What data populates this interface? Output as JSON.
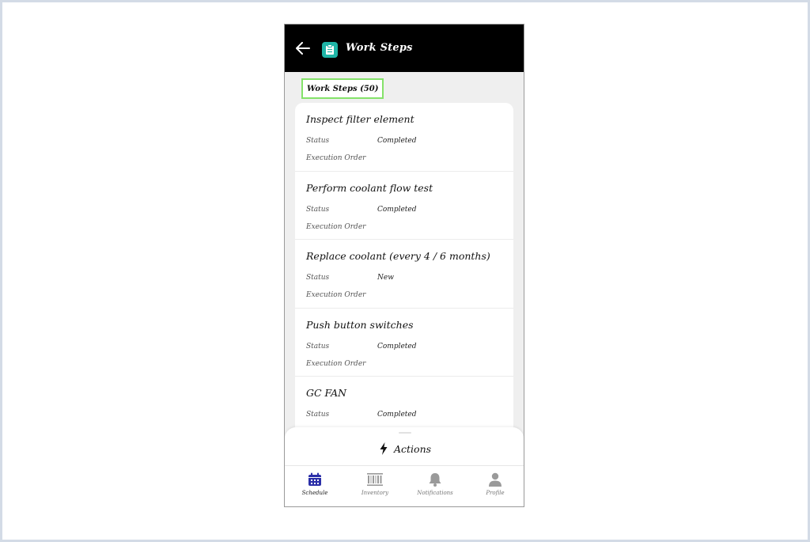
{
  "header": {
    "title": "Work Steps",
    "back_icon": "arrow-left-icon",
    "app_icon": "clipboard-icon",
    "app_icon_color": "#1fb5a7"
  },
  "list": {
    "count_label": "Work Steps (50)",
    "highlight_color": "#84e26a",
    "status_label": "Status",
    "execution_label": "Execution Order",
    "items": [
      {
        "title": "Inspect filter element",
        "status": "Completed"
      },
      {
        "title": "Perform coolant flow test",
        "status": "Completed"
      },
      {
        "title": "Replace coolant (every 4 / 6 months)",
        "status": "New"
      },
      {
        "title": "Push button switches",
        "status": "Completed"
      },
      {
        "title": "GC FAN",
        "status": "Completed"
      }
    ]
  },
  "actions": {
    "label": "Actions",
    "icon": "lightning-bolt-icon"
  },
  "tabbar": {
    "accent_color": "#2b2fa8",
    "tabs": [
      {
        "label": "Schedule",
        "icon": "calendar-icon",
        "active": true
      },
      {
        "label": "Inventory",
        "icon": "barcode-icon",
        "active": false
      },
      {
        "label": "Notifications",
        "icon": "bell-icon",
        "active": false
      },
      {
        "label": "Profile",
        "icon": "user-icon",
        "active": false
      }
    ]
  }
}
